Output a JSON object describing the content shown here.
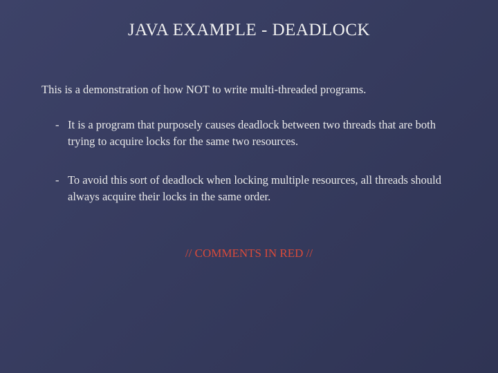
{
  "slide": {
    "title": "JAVA EXAMPLE - DEADLOCK",
    "intro": "This is a demonstration of how NOT to write multi-threaded programs.",
    "bullets": [
      "It is a program that purposely causes deadlock between two threads that are both trying to acquire locks for the same two resources.",
      "To avoid this sort of deadlock when locking multiple resources, all threads should always acquire their locks in the same order."
    ],
    "comment_note": "// COMMENTS IN RED //"
  }
}
